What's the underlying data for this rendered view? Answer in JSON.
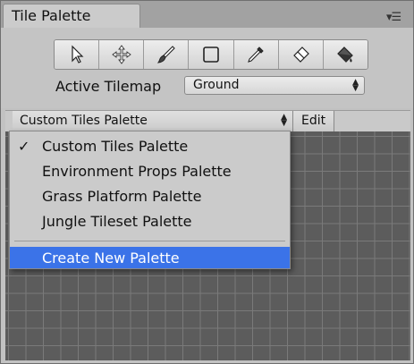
{
  "window": {
    "tab_title": "Tile Palette"
  },
  "toolbar": {
    "tools": [
      {
        "name": "select-tool",
        "icon": "arrow-cursor-icon"
      },
      {
        "name": "move-tool",
        "icon": "move-arrows-icon"
      },
      {
        "name": "paint-tool",
        "icon": "brush-icon"
      },
      {
        "name": "box-fill-tool",
        "icon": "rectangle-icon"
      },
      {
        "name": "picker-tool",
        "icon": "eyedropper-icon"
      },
      {
        "name": "erase-tool",
        "icon": "eraser-icon"
      },
      {
        "name": "fill-tool",
        "icon": "paint-bucket-icon"
      }
    ],
    "active_tilemap_label": "Active Tilemap",
    "active_tilemap_value": "Ground"
  },
  "palette_bar": {
    "selected_palette": "Custom Tiles Palette",
    "edit_label": "Edit"
  },
  "dropdown": {
    "items": [
      {
        "label": "Custom Tiles Palette",
        "checked": true
      },
      {
        "label": "Environment Props Palette",
        "checked": false
      },
      {
        "label": "Grass Platform Palette",
        "checked": false
      },
      {
        "label": "Jungle Tileset Palette",
        "checked": false
      }
    ],
    "create_label": "Create New Palette",
    "check_mark": "✓"
  },
  "colors": {
    "highlight": "#3b73e8",
    "grid_background": "#5c5c5c",
    "panel": "#c2c2c2"
  }
}
